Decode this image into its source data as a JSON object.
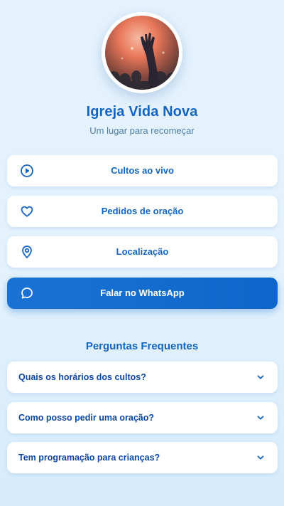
{
  "profile": {
    "name": "Igreja Vida Nova",
    "tagline": "Um lugar para recomeçar"
  },
  "actions": [
    {
      "label": "Cultos ao vivo",
      "icon": "play-circle-icon"
    },
    {
      "label": "Pedidos de oração",
      "icon": "heart-icon"
    },
    {
      "label": "Localização",
      "icon": "map-pin-icon"
    },
    {
      "label": "Falar no WhatsApp",
      "icon": "chat-bubble-icon"
    }
  ],
  "faq": {
    "title": "Perguntas Frequentes",
    "items": [
      {
        "question": "Quais os horários dos cultos?"
      },
      {
        "question": "Como posso pedir uma oração?"
      },
      {
        "question": "Tem programação para crianças?"
      }
    ]
  },
  "colors": {
    "accent": "#1565c0",
    "primary_button": "#1a73d4",
    "background": "#e3f2fd"
  }
}
